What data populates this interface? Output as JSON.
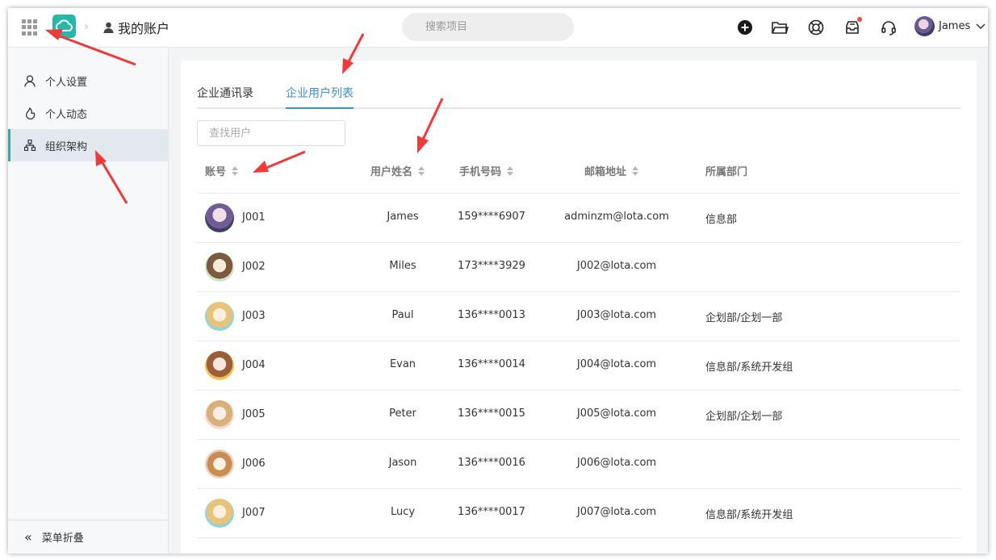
{
  "header": {
    "breadcrumb": "我的账户",
    "search_placeholder": "搜索项目",
    "user_name": "James",
    "icons": [
      "apps-grid-icon",
      "app-logo",
      "add-icon",
      "folder-icon",
      "help-ring-icon",
      "inbox-icon",
      "headset-icon"
    ]
  },
  "sidebar": {
    "items": [
      {
        "label": "个人设置",
        "icon": "person-icon"
      },
      {
        "label": "个人动态",
        "icon": "activity-icon"
      },
      {
        "label": "组织架构",
        "icon": "org-chart-icon",
        "active": true
      }
    ],
    "collapse_label": "菜单折叠"
  },
  "tabs": [
    "企业通讯录",
    "企业用户列表"
  ],
  "active_tab": "企业用户列表",
  "user_search_placeholder": "查找用户",
  "table": {
    "columns": [
      "账号",
      "用户姓名",
      "手机号码",
      "邮箱地址",
      "所属部门"
    ],
    "rows": [
      {
        "account": "J001",
        "name": "James",
        "phone": "159****6907",
        "email": "adminzm@lota.com",
        "dept": "信息部"
      },
      {
        "account": "J002",
        "name": "Miles",
        "phone": "173****3929",
        "email": "J002@lota.com",
        "dept": ""
      },
      {
        "account": "J003",
        "name": "Paul",
        "phone": "136****0013",
        "email": "J003@lota.com",
        "dept": "企划部/企划一部"
      },
      {
        "account": "J004",
        "name": "Evan",
        "phone": "136****0014",
        "email": "J004@lota.com",
        "dept": "信息部/系统开发组"
      },
      {
        "account": "J005",
        "name": "Peter",
        "phone": "136****0015",
        "email": "J005@lota.com",
        "dept": "企划部/企划一部"
      },
      {
        "account": "J006",
        "name": "Jason",
        "phone": "136****0016",
        "email": "J006@lota.com",
        "dept": ""
      },
      {
        "account": "J007",
        "name": "Lucy",
        "phone": "136****0017",
        "email": "J007@lota.com",
        "dept": "信息部/系统开发组"
      }
    ]
  },
  "colors": {
    "accent": "#3b8fd6",
    "brand": "#27b7a6",
    "annotation_arrow": "#f03a3a"
  }
}
